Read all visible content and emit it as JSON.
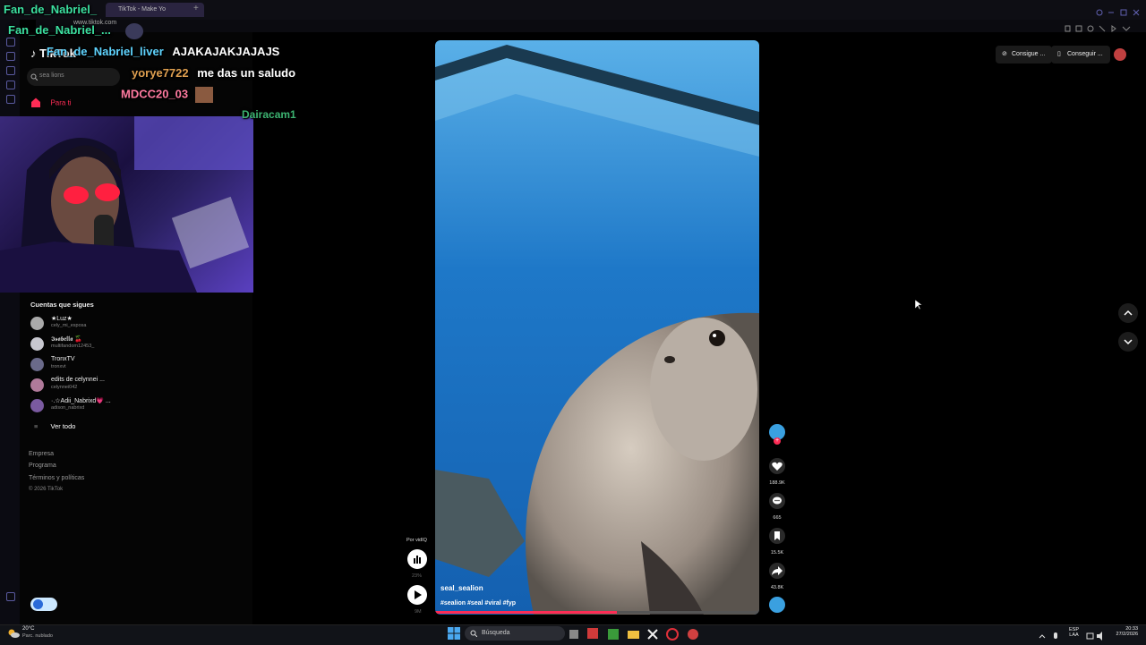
{
  "browser": {
    "tabs": [
      "TikTok - Make Yo"
    ],
    "url": "www.tiktok.com"
  },
  "stream_overlay": {
    "channel_1": "Fan_de_Nabriel_",
    "channel_2": "Fan_de_Nabriel_...",
    "chat": [
      {
        "user": "Fan_de_Nabriel_liver",
        "message": "AJAKAJAKJAJAJS",
        "user_color": "#5fd4ff"
      },
      {
        "user": "yorye7722",
        "message": "me das un saludo",
        "user_color": "#e0a050"
      },
      {
        "user": "MDCC20_03",
        "message": "",
        "user_color": "#ff7aa0"
      },
      {
        "user": "Dairacam1",
        "message": "",
        "user_color": "#3cb371"
      }
    ]
  },
  "tiktok": {
    "logo_text": "TikTok",
    "search_placeholder": "sea lions",
    "nav_para_ti": "Para ti",
    "following_title": "Cuentas que sigues",
    "following": [
      {
        "name": "★Luz★",
        "user": "cely_mi_esposa"
      },
      {
        "name": "𝕴𝖘𝖆𝖇𝖊𝖑𝖑𝖆 🍒",
        "user": "multifandom12453_"
      },
      {
        "name": "TronxTV",
        "user": "tronxvt"
      },
      {
        "name": "edits de celynnei ...",
        "user": "celynnei042"
      },
      {
        "name": "·.☆Adii_Nabrixd💗 ...",
        "user": "adison_nabrixd"
      }
    ],
    "see_all": "Ver todo",
    "footer": [
      "Empresa",
      "Programa",
      "Términos y políticas",
      "© 2026 TikTok"
    ],
    "top_buttons": [
      "Consigue ...",
      "Conseguir ..."
    ]
  },
  "video": {
    "author": "seal_sealion",
    "hashtags": "#sealion #seal #viral #fyp",
    "likes": "188.9K",
    "comments": "665",
    "saves": "15.5K",
    "shares": "43.8K",
    "progress": 0.56
  },
  "player_widget": {
    "label": "Por vidIQ",
    "pct": "23%",
    "time": "9M"
  },
  "taskbar": {
    "weather_temp": "20°C",
    "weather_desc": "Parc. nublado",
    "search_label": "Búsqueda",
    "lang_1": "ESP",
    "lang_2": "LAA",
    "time": "20:33",
    "date": "27/2/2026"
  },
  "colors": {
    "accent": "#fe2c55",
    "water": "#1e78c8"
  }
}
